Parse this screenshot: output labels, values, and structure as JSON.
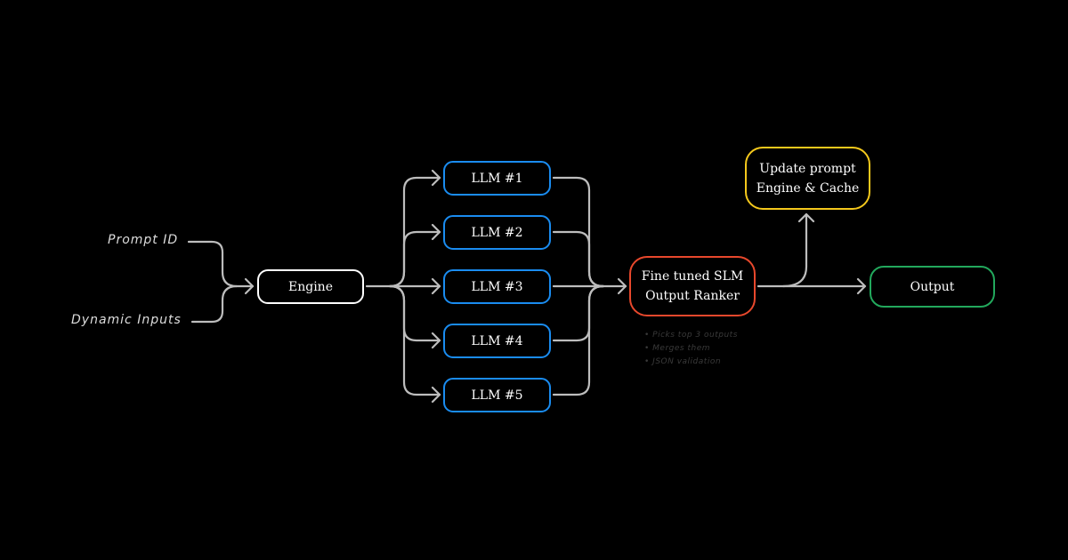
{
  "inputs": {
    "prompt_id": "Prompt ID",
    "dynamic_inputs": "Dynamic Inputs"
  },
  "engine": {
    "label": "Engine",
    "color": "#ffffff"
  },
  "llms": [
    {
      "label": "LLM  #1"
    },
    {
      "label": "LLM  #2"
    },
    {
      "label": "LLM  #3"
    },
    {
      "label": "LLM  #4"
    },
    {
      "label": "LLM  #5"
    }
  ],
  "llm_color": "#1a8cf0",
  "ranker": {
    "line1": "Fine tuned SLM",
    "line2": "Output Ranker",
    "color": "#e8482c",
    "notes": [
      "• Picks top 3 outputs",
      "• Merges them",
      "• JSON validation"
    ]
  },
  "update": {
    "line1": "Update prompt",
    "line2": "Engine & Cache",
    "color": "#f4c81c"
  },
  "output": {
    "label": "Output",
    "color": "#22a85c"
  },
  "connector_color": "#bdbdbd"
}
